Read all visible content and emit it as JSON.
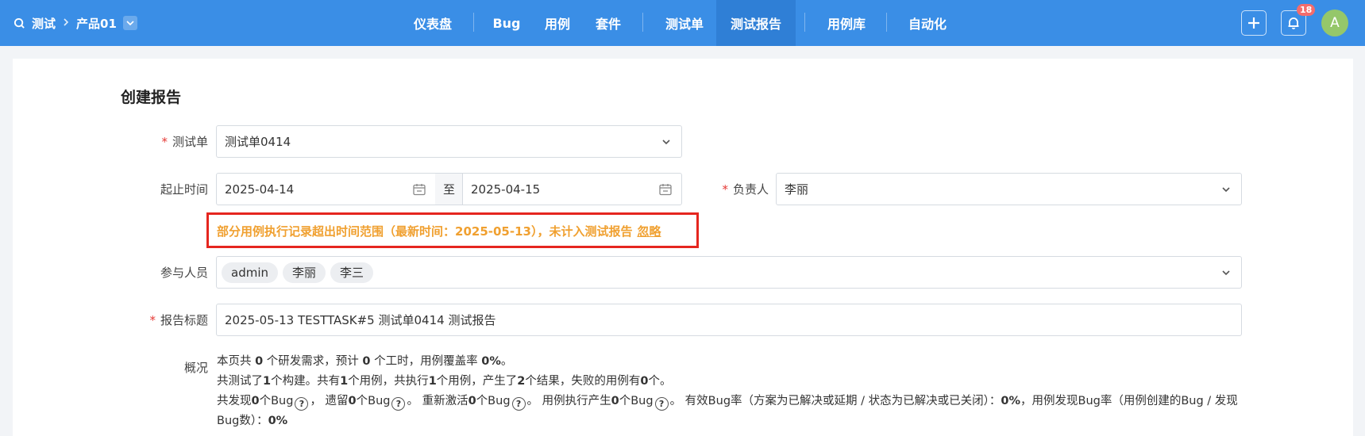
{
  "breadcrumb": {
    "root": "测试",
    "product": "产品01"
  },
  "nav": {
    "items": [
      "仪表盘",
      "Bug",
      "用例",
      "套件",
      "测试单",
      "测试报告",
      "用例库",
      "自动化"
    ],
    "active": "测试报告"
  },
  "toolbar": {
    "notification_count": "18",
    "avatar_letter": "A"
  },
  "form": {
    "title": "创建报告",
    "testtask": {
      "label": "测试单",
      "value": "测试单0414"
    },
    "dates": {
      "label": "起止时间",
      "start": "2025-04-14",
      "to": "至",
      "end": "2025-04-15"
    },
    "owner": {
      "label": "负责人",
      "value": "李丽"
    },
    "warning": {
      "text": "部分用例执行记录超出时间范围（最新时间：2025-05-13），未计入测试报告",
      "ignore": "忽略"
    },
    "members": {
      "label": "参与人员",
      "tags": [
        "admin",
        "李丽",
        "李三"
      ]
    },
    "report_title": {
      "label": "报告标题",
      "value": "2025-05-13 TESTTASK#5 测试单0414 测试报告"
    },
    "summary": {
      "label": "概况",
      "line1": {
        "a": "本页共 ",
        "n1": "0",
        "b": " 个研发需求，预计 ",
        "n2": "0",
        "c": " 个工时，用例覆盖率 ",
        "n3": "0%",
        "d": "。"
      },
      "line2": {
        "a": "共测试了",
        "n1": "1",
        "b": "个构建。共有",
        "n2": "1",
        "c": "个用例，共执行",
        "n3": "1",
        "d": "个用例，产生了",
        "n4": "2",
        "e": "个结果，失败的用例有",
        "n5": "0",
        "f": "个。"
      },
      "line3": {
        "a": "共发现",
        "n1": "0",
        "b": "个Bug",
        "c": "， 遗留",
        "n2": "0",
        "d": "个Bug",
        "e": "。 重新激活",
        "n3": "0",
        "f": "个Bug",
        "g": "。 用例执行产生",
        "n4": "0",
        "h": "个Bug",
        "i": "。 有效Bug率（方案为已解决或延期 / 状态为已解决或已关闭）：",
        "n5": "0%",
        "j": "，用例发现Bug率（用例创建的Bug / 发现Bug数）：",
        "n6": "0%"
      },
      "help_glyph": "?"
    }
  },
  "icons": [
    "search-icon",
    "chevron-right-icon",
    "chevron-down-icon",
    "calendar-icon",
    "plus-icon",
    "bell-icon",
    "help-circle-icon"
  ]
}
